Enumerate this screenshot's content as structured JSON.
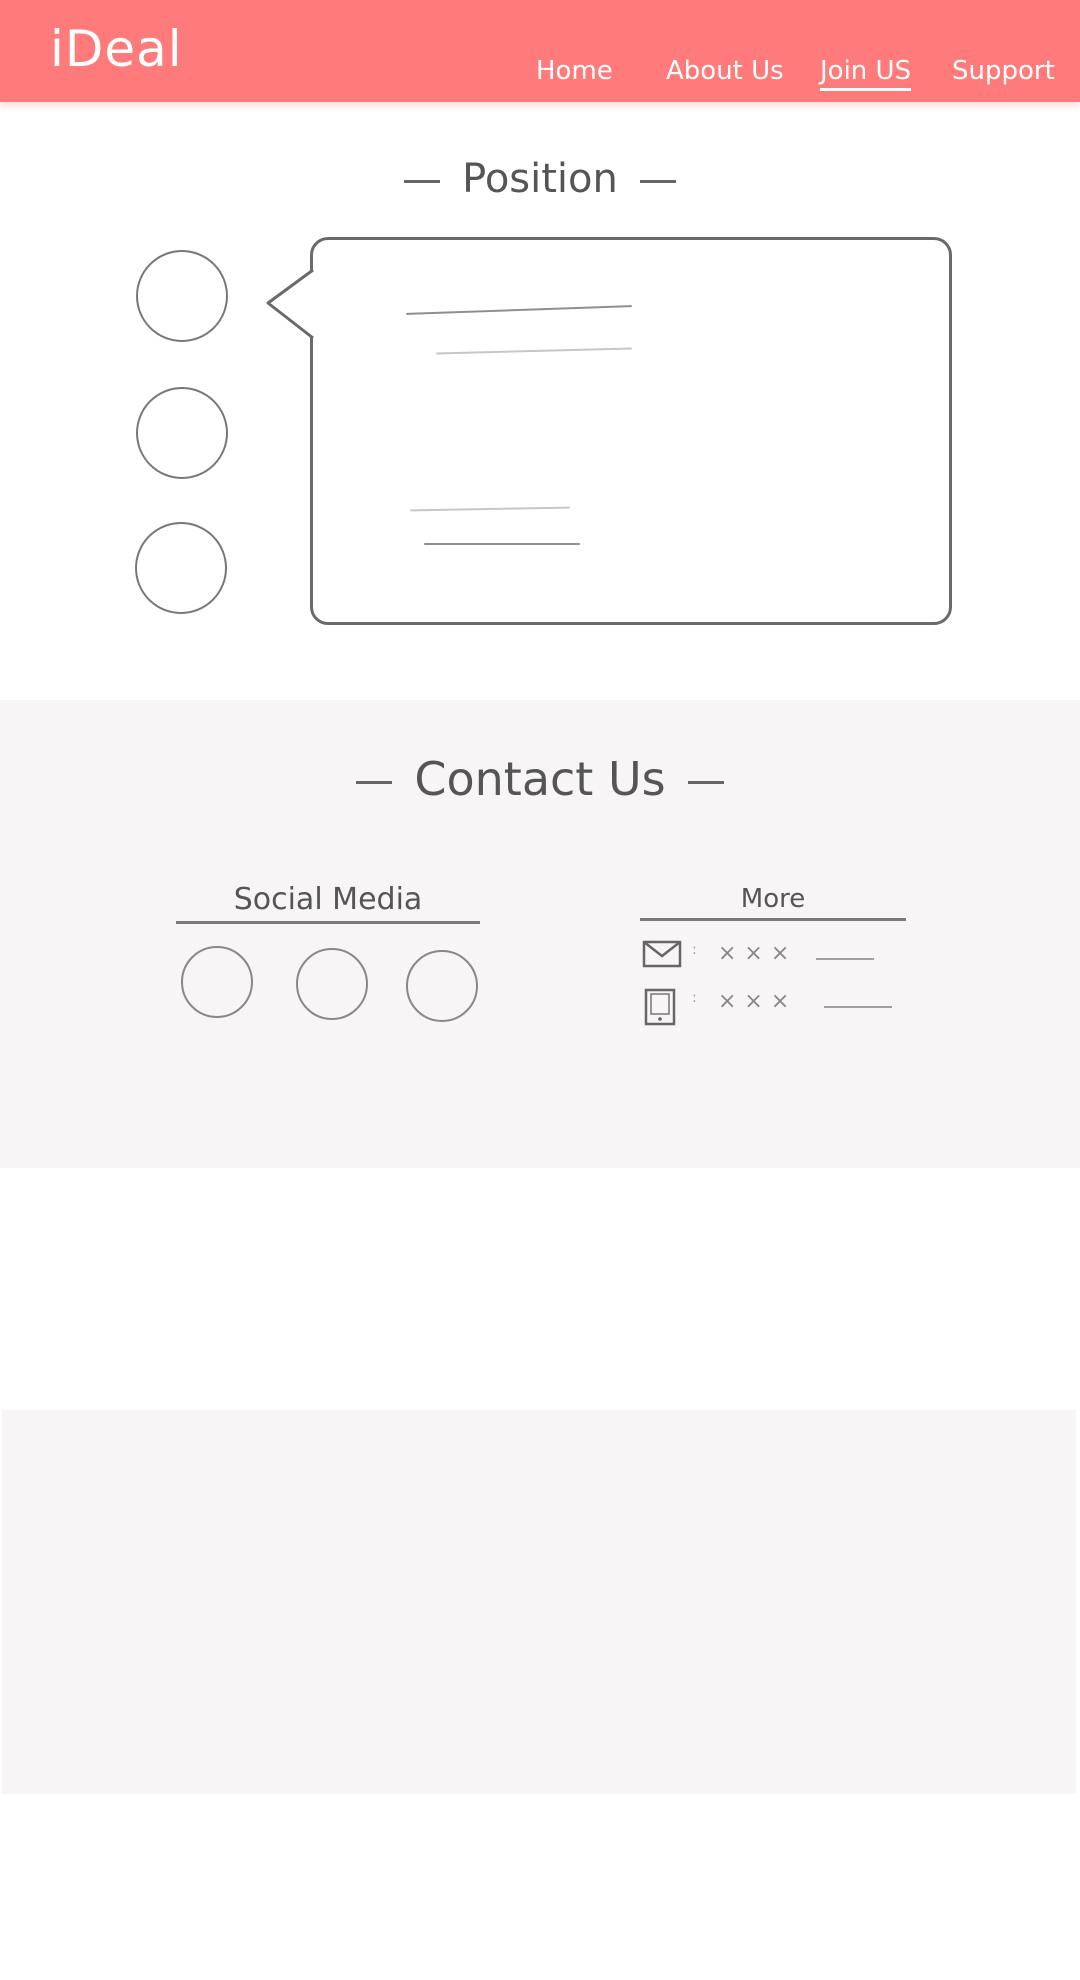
{
  "header": {
    "logo": "iDeal",
    "nav": [
      {
        "label": "Home"
      },
      {
        "label": "About Us"
      },
      {
        "label": "Join US"
      },
      {
        "label": "Support"
      }
    ],
    "active_nav": "Join US",
    "background_color": "#ff7b7b"
  },
  "position": {
    "title": "Position"
  },
  "contact": {
    "title": "Contact Us",
    "social": {
      "heading": "Social Media"
    },
    "more": {
      "heading": "More",
      "rows": [
        {
          "icon": "mail-icon",
          "separator": ":",
          "value": "×××"
        },
        {
          "icon": "phone-icon",
          "separator": ":",
          "value": "×××"
        }
      ]
    },
    "background_color": "#f7f5f6"
  }
}
